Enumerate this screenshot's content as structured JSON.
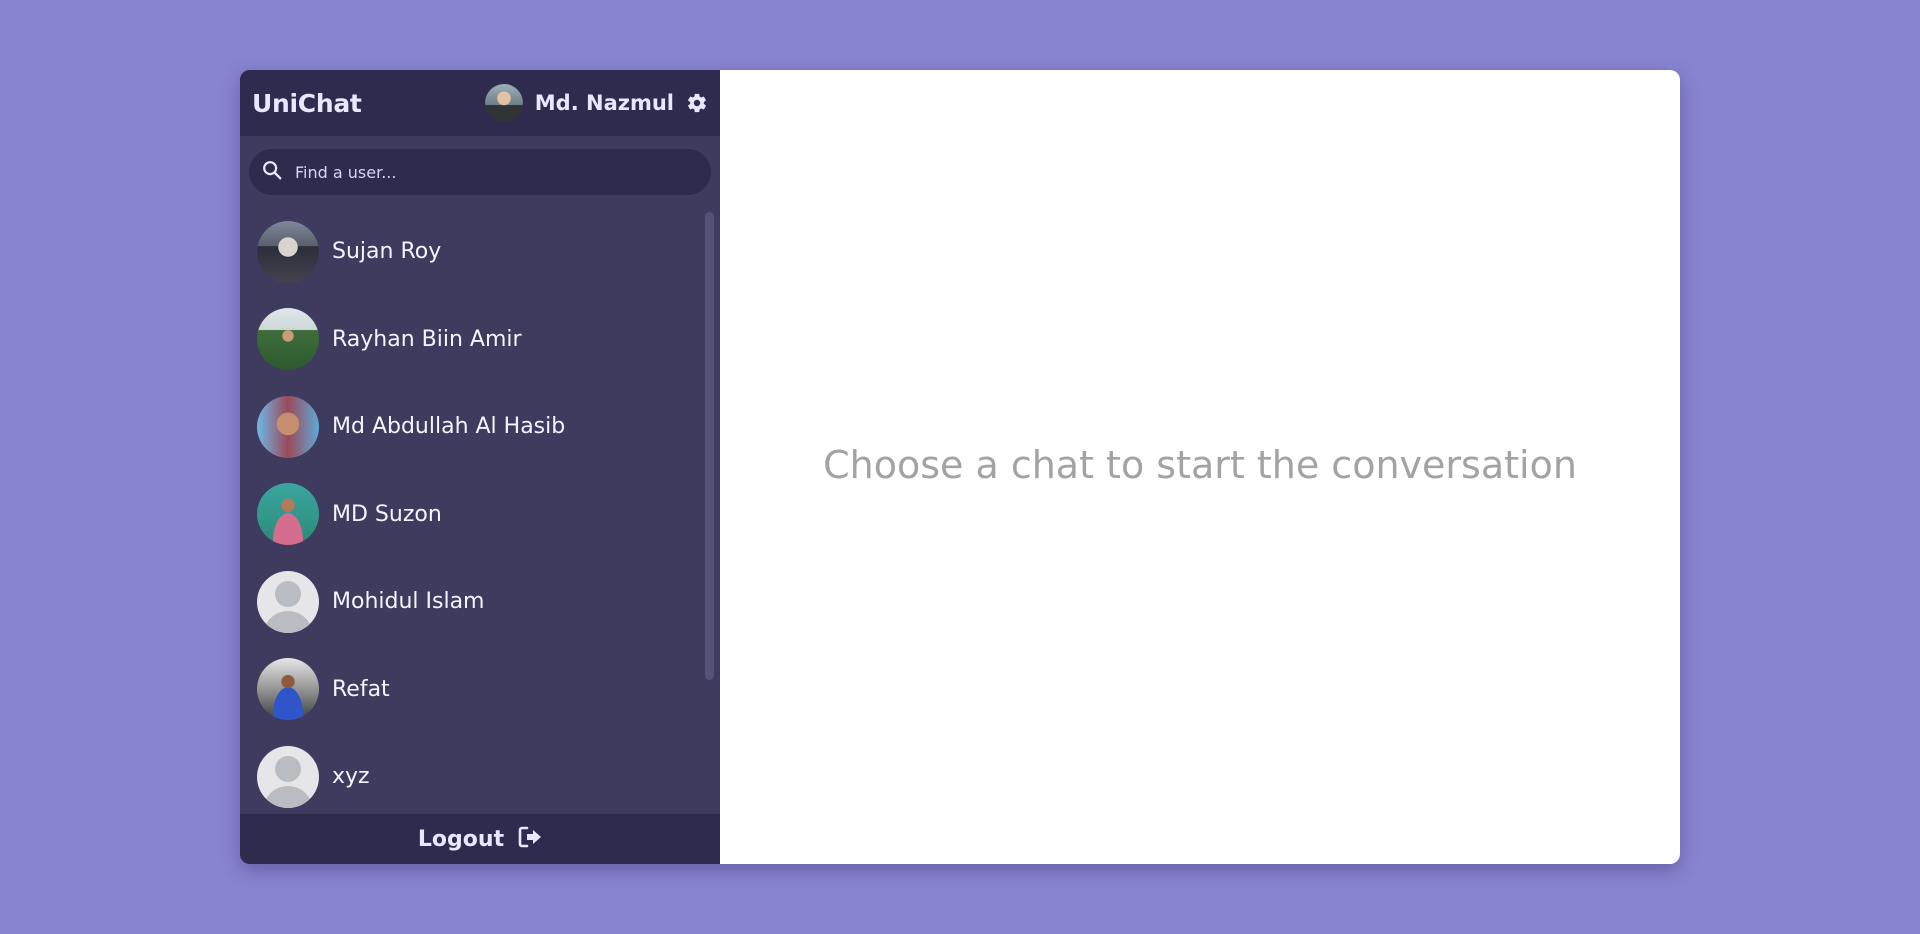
{
  "app": {
    "title": "UniChat",
    "accent": "#2e2b4f",
    "sidebar_bg": "#3e3b5e",
    "page_bg": "#8884d0"
  },
  "navbar": {
    "user_name": "Md. Nazmul",
    "settings_icon": "gear-icon"
  },
  "search": {
    "placeholder": "Find a user...",
    "value": "",
    "icon": "search-icon"
  },
  "chats": [
    {
      "name": "Sujan Roy",
      "avatar": "photo"
    },
    {
      "name": "Rayhan Biin Amir",
      "avatar": "photo"
    },
    {
      "name": "Md Abdullah Al Hasib",
      "avatar": "photo"
    },
    {
      "name": "MD Suzon",
      "avatar": "photo"
    },
    {
      "name": "Mohidul Islam",
      "avatar": "default-user-icon"
    },
    {
      "name": "Refat",
      "avatar": "photo"
    },
    {
      "name": "xyz",
      "avatar": "default-user-icon"
    }
  ],
  "logout": {
    "label": "Logout",
    "icon": "sign-out-icon"
  },
  "main": {
    "placeholder_text": "Choose a chat to start the conversation"
  }
}
